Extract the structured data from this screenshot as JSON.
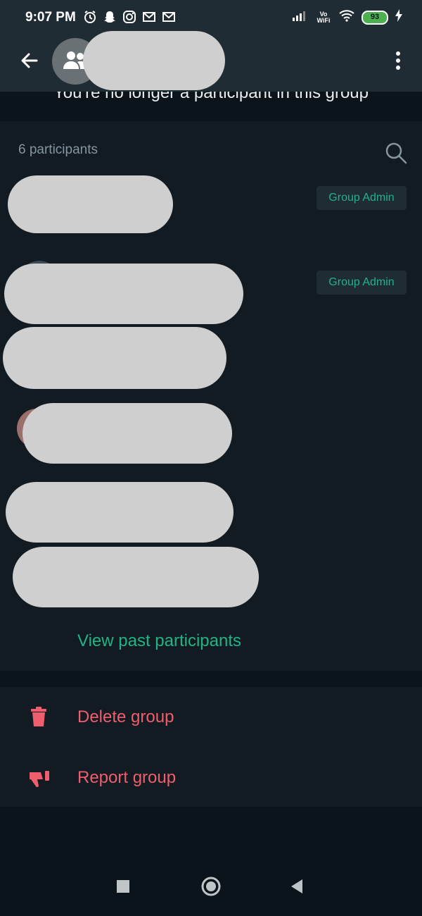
{
  "status_bar": {
    "time": "9:07 PM",
    "left_icons": [
      "alarm-icon",
      "snapchat-icon",
      "instagram-icon",
      "gmail-icon",
      "gmail-icon"
    ],
    "network_label": "Vo WiFi",
    "battery_level": "93"
  },
  "app_bar": {
    "back_icon": "back-arrow-icon",
    "avatar_icon": "group-icon",
    "menu_icon": "more-vert-icon"
  },
  "notice": "You're no longer a participant in this group",
  "participants": {
    "count_label": "6 participants",
    "search_icon": "search-icon",
    "admin_badges": [
      "Group Admin",
      "Group Admin"
    ],
    "view_past_label": "View past participants"
  },
  "actions": {
    "delete_label": "Delete group",
    "report_label": "Report group"
  },
  "colors": {
    "accent": "#20b38a",
    "danger": "#ef5e6e",
    "background": "#0b141a",
    "panel": "#111b21",
    "appbar": "#1f2c34"
  },
  "nav_bar": {
    "icons": [
      "recents-square-icon",
      "home-circle-icon",
      "back-triangle-icon"
    ]
  }
}
